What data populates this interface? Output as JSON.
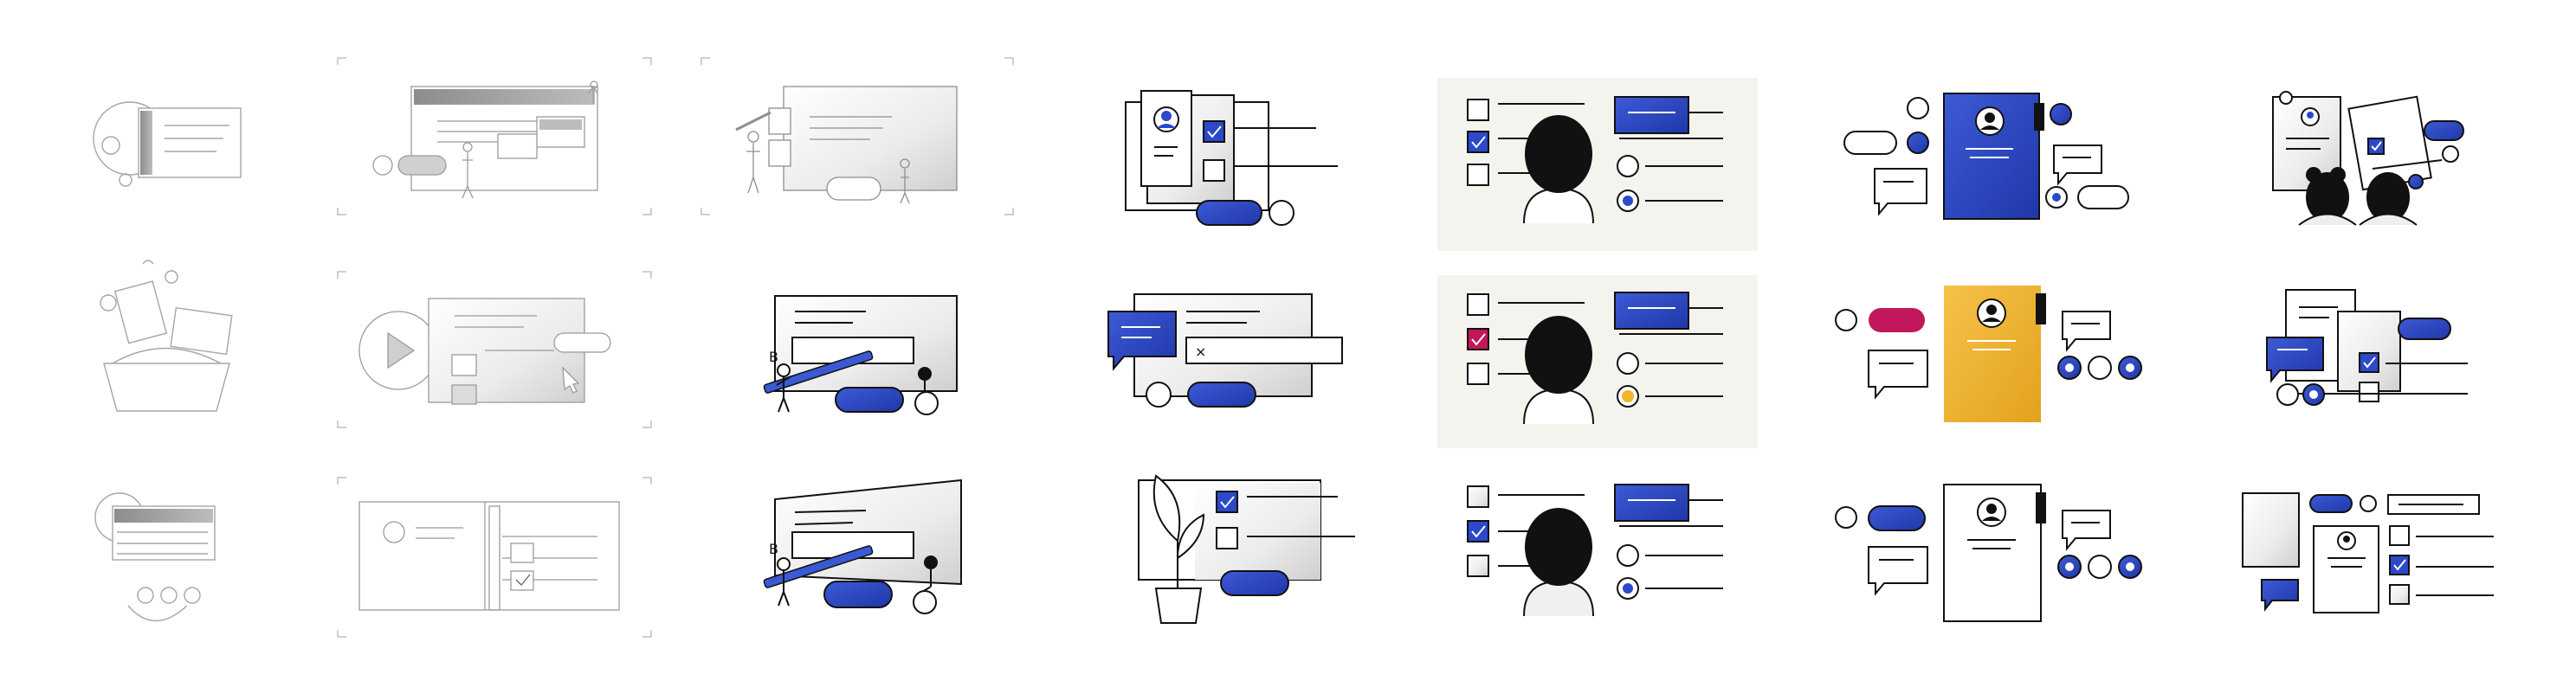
{
  "sheet": {
    "title": "",
    "background": "#ffffff"
  },
  "colors": {
    "ink": "#111111",
    "sketch": "#9a9a9a",
    "sketch_light": "#c8c8c8",
    "blue": "#2b49c9",
    "blue_light": "#5a74e0",
    "magenta": "#c2185b",
    "yellow": "#f2b52a",
    "paper": "#f3f1ec",
    "grey_fill": "#e6e6e6"
  },
  "icons": {
    "check": "check-icon",
    "cross": "x-mark-icon",
    "person": "person-avatar-icon",
    "radio": "radio-icon",
    "speech": "speech-bubble-icon",
    "play": "play-icon",
    "leaf": "plant-icon"
  },
  "columns": [
    {
      "name": "col-1-rough-sketches",
      "style": "pencil"
    },
    {
      "name": "col-2-storyboard-sketches",
      "style": "pencil"
    },
    {
      "name": "col-3-form-people",
      "style": "ink"
    },
    {
      "name": "col-4-profile-forms",
      "style": "ink-blue"
    },
    {
      "name": "col-5-head-checklists",
      "style": "ink-blue-accents"
    },
    {
      "name": "col-6-color-cards",
      "style": "ink-color"
    },
    {
      "name": "col-7-team-documents",
      "style": "ink-blue"
    }
  ],
  "labels": {
    "form_x_mark": "×",
    "pencil_letter_top": "B",
    "pencil_letter_bottom": "B"
  }
}
